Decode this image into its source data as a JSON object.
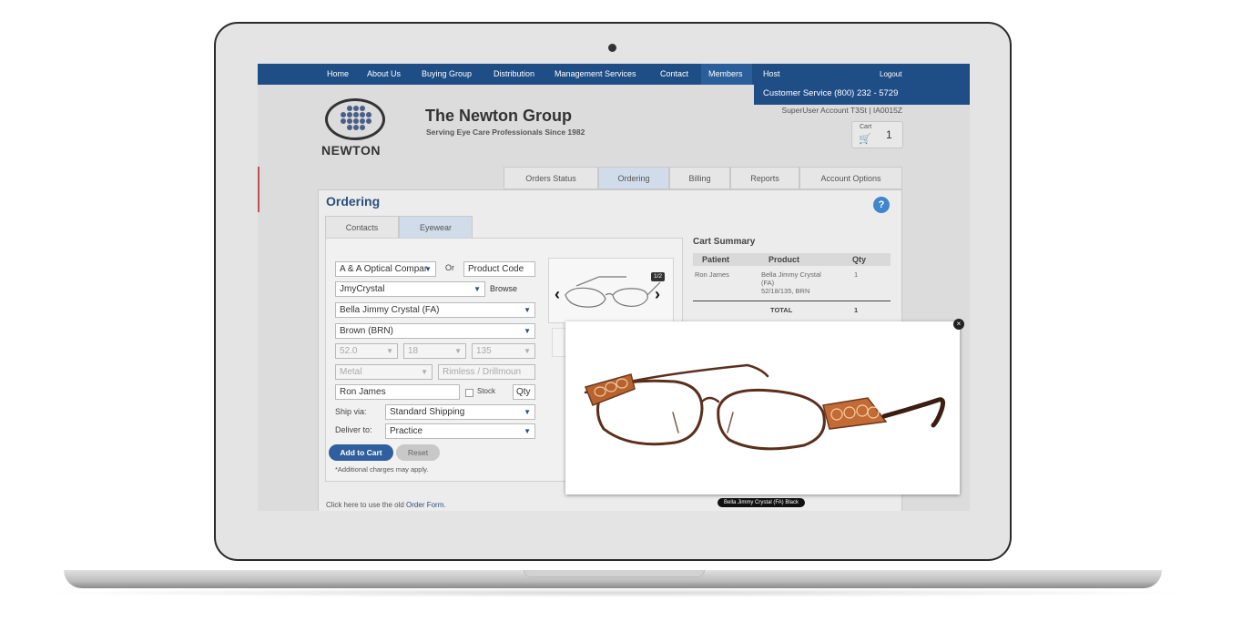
{
  "nav": {
    "items": [
      "Home",
      "About Us",
      "Buying Group",
      "Distribution",
      "Management Services",
      "Contact",
      "Members",
      "Host"
    ],
    "logout": "Logout"
  },
  "header": {
    "customer_service": "Customer Service (800) 232 - 5729",
    "account": "SuperUser Account T3St | IA0015Z",
    "logo_text": "NEWTON",
    "title": "The Newton Group",
    "tagline": "Serving Eye Care Professionals Since 1982",
    "cart_label": "Cart",
    "cart_count": "1"
  },
  "tabs": [
    "Orders Status",
    "Ordering",
    "Billing",
    "Reports",
    "Account Options"
  ],
  "panel": {
    "title": "Ordering",
    "help": "?",
    "subtabs": [
      "Contacts",
      "Eyewear"
    ]
  },
  "form": {
    "vendor": "A & A Optical Compar",
    "or_label": "Or",
    "product_code_placeholder": "Product Code",
    "collection": "JmyCrystal",
    "browse": "Browse",
    "frame": "Bella Jimmy Crystal (FA)",
    "color": "Brown (BRN)",
    "eye_size": "52.0",
    "bridge": "18",
    "temple": "135",
    "material": "Metal",
    "rim": "Rimless / Drillmoun",
    "patient": "Ron James",
    "stock_label": "Stock",
    "qty_placeholder": "Qty",
    "ship_via_label": "Ship via:",
    "ship_via": "Standard Shipping",
    "deliver_to_label": "Deliver to:",
    "deliver_to": "Practice",
    "add_to_cart": "Add to Cart",
    "reset": "Reset",
    "note": "*Additional charges may apply.",
    "footer_prefix": "Click here to use the old ",
    "footer_link": "Order Form",
    "footer_suffix": "."
  },
  "viewer": {
    "badge": "1/2"
  },
  "summary": {
    "title": "Cart Summary",
    "headers": [
      "Patient",
      "Product",
      "Qty"
    ],
    "row": {
      "patient": "Ron James",
      "product_line1": "Bella Jimmy Crystal",
      "product_line2": "(FA)",
      "product_line3": "52/18/135, BRN",
      "qty": "1"
    },
    "total_label": "TOTAL",
    "total_qty": "1"
  },
  "popup": {
    "close": "×",
    "caption": "Bella Jimmy Crystal (FA) Black"
  },
  "colors": {
    "nav": "#1f4e86",
    "accent": "#2f5f9e",
    "frame_brown": "#6b3a22",
    "crystal": "#c46a34"
  }
}
